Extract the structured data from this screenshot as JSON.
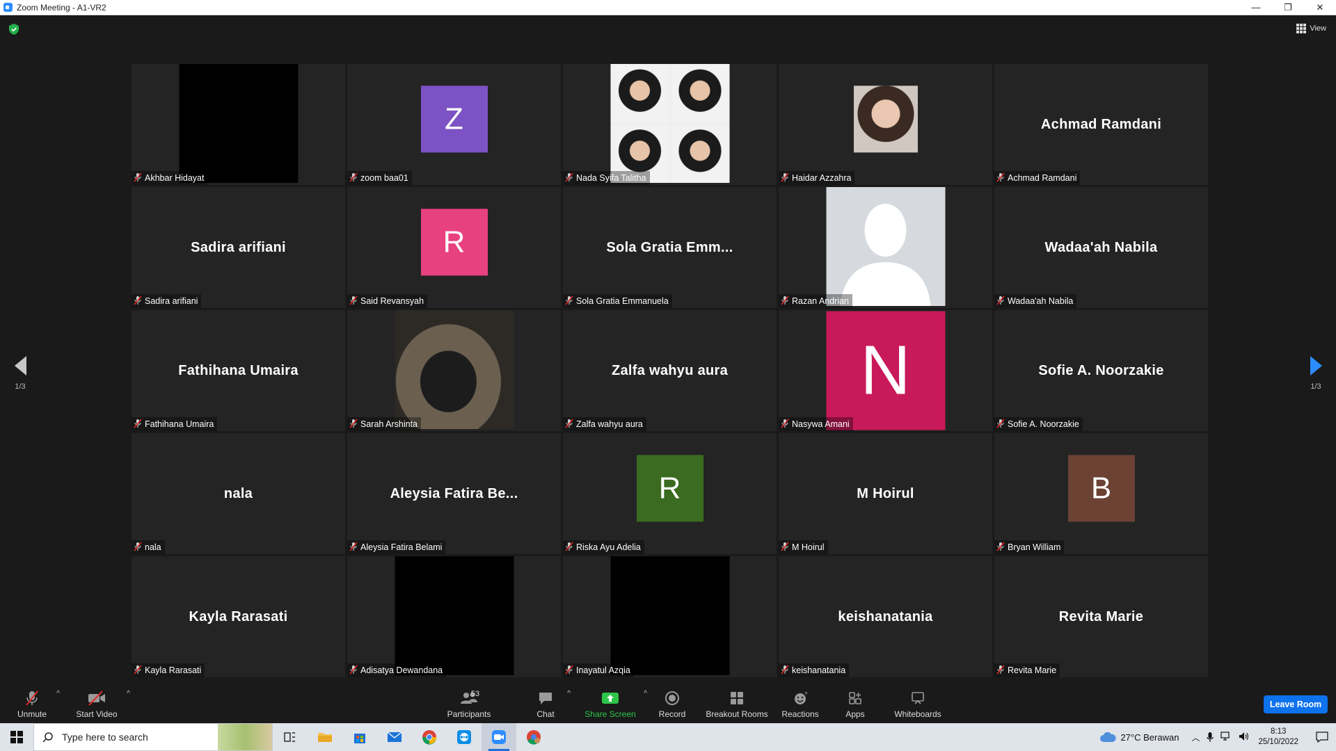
{
  "window": {
    "title": "Zoom Meeting - A1-VR2",
    "minimize": "—",
    "restore": "❐",
    "close": "✕"
  },
  "view_label": "View",
  "pagination": {
    "left": "1/3",
    "right": "1/3"
  },
  "tiles": [
    {
      "name": "Akhbar Hidayat",
      "type": "video",
      "video_color": "#000000"
    },
    {
      "name": "zoom baa01",
      "type": "avatar",
      "letter": "Z",
      "color": "#7c52c4"
    },
    {
      "name": "Nada Syifa Talitha",
      "type": "photo-quad"
    },
    {
      "name": "Haidar Azzahra",
      "type": "photo-small"
    },
    {
      "name": "Achmad Ramdani",
      "type": "text",
      "display": "Achmad Ramdani"
    },
    {
      "name": "Sadira arifiani",
      "type": "text",
      "display": "Sadira arifiani"
    },
    {
      "name": "Said Revansyah",
      "type": "avatar",
      "letter": "R",
      "color": "#e8417f"
    },
    {
      "name": "Sola Gratia Emmanuela",
      "type": "text",
      "display": "Sola Gratia Emm..."
    },
    {
      "name": "Razan Andrian",
      "type": "silhouette"
    },
    {
      "name": "Wadaa'ah Nabila",
      "type": "text",
      "display": "Wadaa'ah Nabila"
    },
    {
      "name": "Fathihana Umaira",
      "type": "text",
      "display": "Fathihana Umaira"
    },
    {
      "name": "Sarah Arshinta",
      "type": "photo-mask"
    },
    {
      "name": "Zalfa wahyu aura",
      "type": "text",
      "display": "Zalfa wahyu aura"
    },
    {
      "name": "Nasywa Amani",
      "type": "avatar-big",
      "letter": "N",
      "color": "#c8195a"
    },
    {
      "name": "Sofie A. Noorzakie",
      "type": "text",
      "display": "Sofie A. Noorzakie"
    },
    {
      "name": "nala",
      "type": "text",
      "display": "nala"
    },
    {
      "name": "Aleysia Fatira Belami",
      "type": "text",
      "display": "Aleysia Fatira Be..."
    },
    {
      "name": "Riska Ayu Adelia",
      "type": "avatar",
      "letter": "R",
      "color": "#3a6b20"
    },
    {
      "name": "M Hoirul",
      "type": "text",
      "display": "M Hoirul"
    },
    {
      "name": "Bryan William",
      "type": "avatar",
      "letter": "B",
      "color": "#6b4234"
    },
    {
      "name": "Kayla Rarasati",
      "type": "text",
      "display": "Kayla Rarasati"
    },
    {
      "name": "Adisatya Dewandana",
      "type": "video",
      "video_color": "#000000"
    },
    {
      "name": "Inayatul Azqia",
      "type": "video",
      "video_color": "#000000"
    },
    {
      "name": "keishanatania",
      "type": "text",
      "display": "keishanatania"
    },
    {
      "name": "Revita Marie",
      "type": "text",
      "display": "Revita Marie"
    }
  ],
  "toolbar": {
    "unmute": "Unmute",
    "start_video": "Start Video",
    "participants": "Participants",
    "participants_count": "53",
    "chat": "Chat",
    "share_screen": "Share Screen",
    "record": "Record",
    "breakout_rooms": "Breakout Rooms",
    "reactions": "Reactions",
    "apps": "Apps",
    "whiteboards": "Whiteboards",
    "leave_room": "Leave Room"
  },
  "taskbar": {
    "search_placeholder": "Type here to search",
    "weather": "27°C  Berawan",
    "time": "8:13",
    "date": "25/10/2022"
  },
  "colors": {
    "accent_blue": "#2d8cff",
    "share_green": "#2dc54a",
    "leave_blue": "#0e72ed",
    "mute_red": "#e02828"
  }
}
